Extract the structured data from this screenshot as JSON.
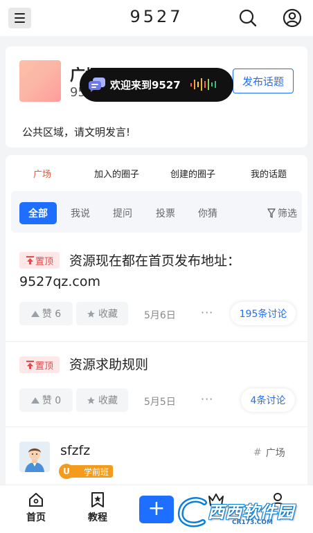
{
  "header": {
    "title": "9527",
    "menu_icon": "menu-icon",
    "search_icon": "search-icon",
    "user_icon": "user-icon"
  },
  "circle": {
    "name": "广场",
    "number": "95",
    "publish_label": "发布话题",
    "notice": "公共区域，请文明发言!"
  },
  "toast": {
    "text": "欢迎来到9527",
    "icon": "chat-bubbles-icon"
  },
  "tabs": [
    {
      "label": "广场",
      "active": true
    },
    {
      "label": "加入的圈子",
      "active": false
    },
    {
      "label": "创建的圈子",
      "active": false
    },
    {
      "label": "我的话题",
      "active": false
    }
  ],
  "filters": {
    "chips": [
      {
        "label": "全部",
        "active": true
      },
      {
        "label": "我说",
        "active": false
      },
      {
        "label": "提问",
        "active": false
      },
      {
        "label": "投票",
        "active": false
      },
      {
        "label": "你猜",
        "active": false
      }
    ],
    "filter_label": "筛选"
  },
  "posts": [
    {
      "badge": "置顶",
      "title": "资源现在都在首页发布地址：9527qz.com",
      "like_label": "赞 6",
      "fav_label": "收藏",
      "date": "5月6日",
      "more": "···",
      "discussions": "195条讨论"
    },
    {
      "badge": "置顶",
      "title": "资源求助规则",
      "like_label": "赞 0",
      "fav_label": "收藏",
      "date": "5月5日",
      "more": "···",
      "discussions": "4条讨论"
    }
  ],
  "user_post": {
    "username": "sfzfz",
    "level": "学前班",
    "level_icon": "U",
    "tag": "广场"
  },
  "bottom_nav": {
    "home": "首页",
    "tutorial": "教程",
    "add": "+",
    "crown_label": "",
    "me_label": ""
  },
  "watermark": {
    "text": "西西软件园",
    "url": "CR173.COM"
  },
  "colors": {
    "accent": "#1e6fff",
    "active_tab": "#e5573b",
    "pin": "#e04b4b",
    "level": "#f59b1b"
  }
}
